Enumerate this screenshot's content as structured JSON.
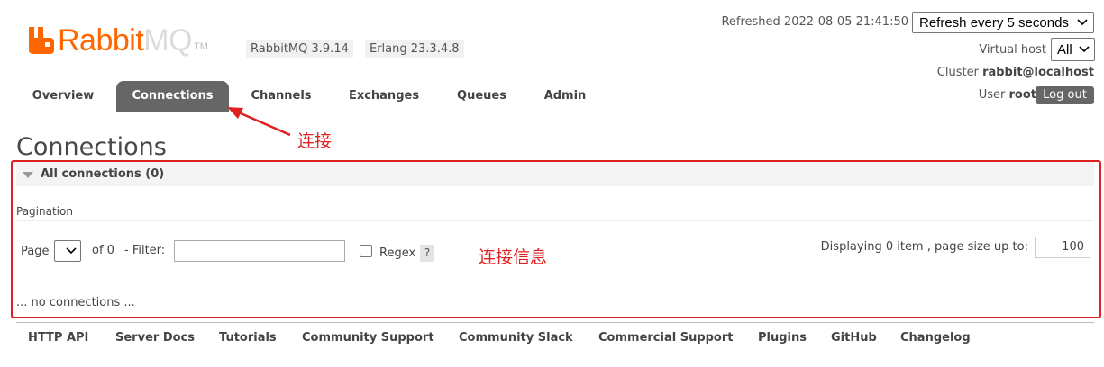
{
  "header": {
    "logo_text_rabbit": "Rabbit",
    "logo_text_mq": "MQ",
    "logo_tm": "TM",
    "rabbitmq_version": "RabbitMQ 3.9.14",
    "erlang_version": "Erlang 23.3.4.8",
    "refreshed": "Refreshed 2022-08-05 21:41:50",
    "refresh_select": "Refresh every 5 seconds",
    "virtual_host_label": "Virtual host",
    "virtual_host_value": "All",
    "cluster_label": "Cluster",
    "cluster_value": "rabbit@localhost",
    "user_label": "User",
    "user_value": "root",
    "logout": "Log out"
  },
  "nav": {
    "tabs": [
      {
        "label": "Overview",
        "active": false
      },
      {
        "label": "Connections",
        "active": true
      },
      {
        "label": "Channels",
        "active": false
      },
      {
        "label": "Exchanges",
        "active": false
      },
      {
        "label": "Queues",
        "active": false
      },
      {
        "label": "Admin",
        "active": false
      }
    ]
  },
  "annotations": {
    "tab_note": "连接",
    "panel_note": "连接信息",
    "color": "#e02020"
  },
  "main": {
    "title": "Connections",
    "section_title": "All connections (0)",
    "pagination_label": "Pagination",
    "page_label": "Page",
    "of_label": "of 0",
    "filter_label": "- Filter:",
    "filter_value": "",
    "regex_label": "Regex",
    "help": "?",
    "display_label": "Displaying 0 item , page size up to:",
    "page_size": "100",
    "empty_message": "... no connections ..."
  },
  "footer": {
    "links": [
      "HTTP API",
      "Server Docs",
      "Tutorials",
      "Community Support",
      "Community Slack",
      "Commercial Support",
      "Plugins",
      "GitHub",
      "Changelog"
    ]
  },
  "colors": {
    "brand": "#ff6600",
    "active_tab": "#666666"
  }
}
